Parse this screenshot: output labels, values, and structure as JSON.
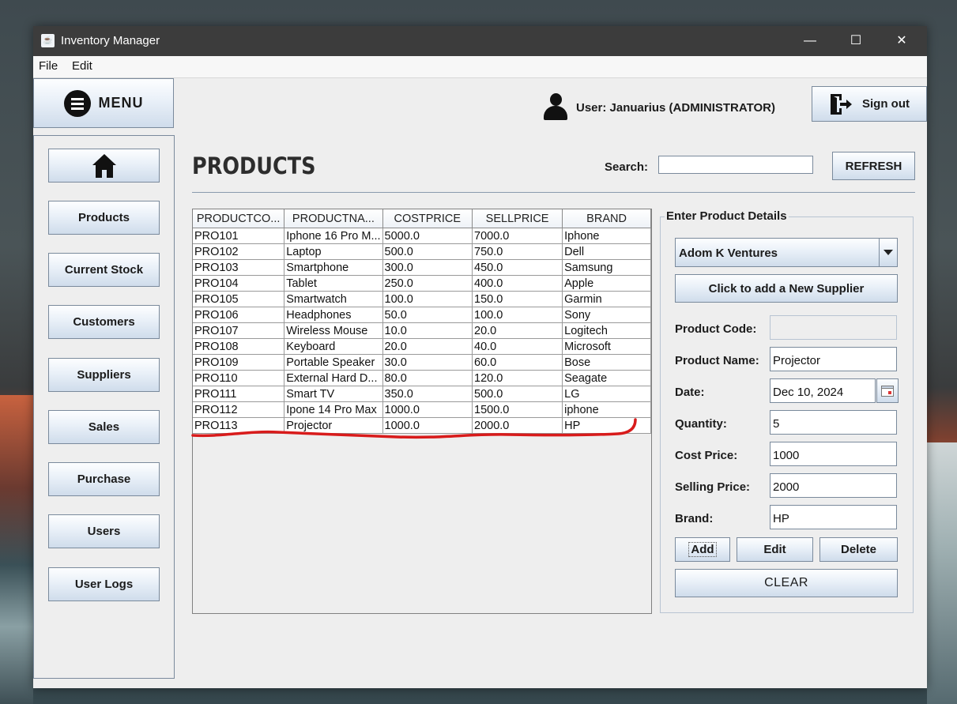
{
  "window": {
    "title": "Inventory Manager",
    "controls": {
      "minimize": "—",
      "maximize": "☐",
      "close": "✕"
    }
  },
  "menubar": {
    "items": [
      "File",
      "Edit"
    ]
  },
  "menu_button": {
    "label": "MENU"
  },
  "sidebar": {
    "items": [
      {
        "label": ""
      },
      {
        "label": "Products"
      },
      {
        "label": "Current Stock"
      },
      {
        "label": "Customers"
      },
      {
        "label": "Suppliers"
      },
      {
        "label": "Sales"
      },
      {
        "label": "Purchase"
      },
      {
        "label": "Users"
      },
      {
        "label": "User Logs"
      }
    ]
  },
  "header": {
    "user_text": "User: Januarius (ADMINISTRATOR)",
    "signout_label": "Sign out"
  },
  "page": {
    "title": "PRODUCTS",
    "search_label": "Search:",
    "search_value": "",
    "refresh_label": "REFRESH"
  },
  "table": {
    "columns": [
      "PRODUCTCO...",
      "PRODUCTNA...",
      "COSTPRICE",
      "SELLPRICE",
      "BRAND"
    ],
    "rows": [
      [
        "PRO101",
        "Iphone 16 Pro M...",
        "5000.0",
        "7000.0",
        "Iphone"
      ],
      [
        "PRO102",
        "Laptop",
        "500.0",
        "750.0",
        "Dell"
      ],
      [
        "PRO103",
        "Smartphone",
        "300.0",
        "450.0",
        "Samsung"
      ],
      [
        "PRO104",
        "Tablet",
        "250.0",
        "400.0",
        "Apple"
      ],
      [
        "PRO105",
        "Smartwatch",
        "100.0",
        "150.0",
        "Garmin"
      ],
      [
        "PRO106",
        "Headphones",
        "50.0",
        "100.0",
        "Sony"
      ],
      [
        "PRO107",
        "Wireless Mouse",
        "10.0",
        "20.0",
        "Logitech"
      ],
      [
        "PRO108",
        "Keyboard",
        "20.0",
        "40.0",
        "Microsoft"
      ],
      [
        "PRO109",
        "Portable Speaker",
        "30.0",
        "60.0",
        "Bose"
      ],
      [
        "PRO110",
        "External Hard D...",
        "80.0",
        "120.0",
        "Seagate"
      ],
      [
        "PRO111",
        "Smart TV",
        "350.0",
        "500.0",
        "LG"
      ],
      [
        "PRO112",
        "Ipone 14 Pro Max",
        "1000.0",
        "1500.0",
        "iphone"
      ],
      [
        "PRO113",
        "Projector",
        "1000.0",
        "2000.0",
        "HP"
      ]
    ]
  },
  "details": {
    "title": "Enter Product Details",
    "supplier_selected": "Adom K Ventures",
    "add_supplier_label": "Click to add a New Supplier",
    "fields": {
      "product_code": {
        "label": "Product Code:",
        "value": ""
      },
      "product_name": {
        "label": "Product Name:",
        "value": "Projector"
      },
      "date": {
        "label": "Date:",
        "value": "Dec 10, 2024"
      },
      "quantity": {
        "label": "Quantity:",
        "value": "5"
      },
      "cost_price": {
        "label": "Cost Price:",
        "value": "1000"
      },
      "selling_price": {
        "label": "Selling Price:",
        "value": "2000"
      },
      "brand": {
        "label": "Brand:",
        "value": "HP"
      }
    },
    "buttons": {
      "add": "Add",
      "edit": "Edit",
      "delete": "Delete",
      "clear": "CLEAR"
    }
  },
  "colors": {
    "annotation": "#d81b1b",
    "titlebar": "#3c3c3c"
  }
}
